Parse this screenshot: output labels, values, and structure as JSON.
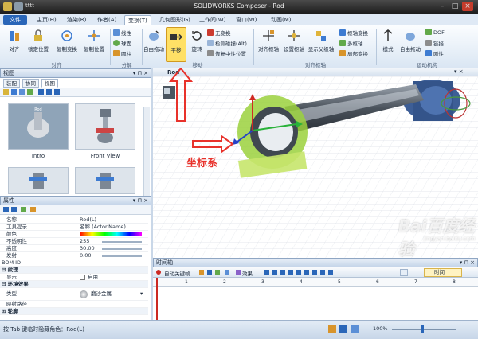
{
  "app": {
    "title": "SOLIDWORKS Composer - Rod",
    "file_tab": "文件",
    "quick_access_doc": "tttt"
  },
  "tabs": [
    {
      "label": "主页(H)"
    },
    {
      "label": "渲染(R)"
    },
    {
      "label": "作者(A)"
    },
    {
      "label": "变换(T)",
      "active": true
    },
    {
      "label": "几何图形(G)"
    },
    {
      "label": "工作间(W)"
    },
    {
      "label": "窗口(W)"
    },
    {
      "label": "动画(M)"
    }
  ],
  "ribbon": {
    "align_group": {
      "label": "对齐",
      "align_button": "对齐",
      "lock_position": "锁定位置",
      "copy_transform": "复制变换",
      "copy_position": "复制位置"
    },
    "explode_group": {
      "label": "分解",
      "linear": "线性",
      "spherical": "球面",
      "cylindrical": "圆柱"
    },
    "move_group": {
      "label": "移动",
      "free_drag": "自由拖动",
      "translate": "平移",
      "rotate": "旋转",
      "no_transform": "无变换",
      "check_collision": "检测碰撞(Alt)",
      "restore_neutral": "恢复中性位置"
    },
    "pivot_group": {
      "label": "对齐枢轴",
      "align_pivot": "对齐枢轴",
      "set_pivot": "设置枢轴",
      "show_parent_pivot": "显示父级轴",
      "pivot_transform": "枢轴变换",
      "multi_pivot": "多枢轴",
      "local_transform": "局部变换"
    },
    "kinematics_group": {
      "label": "运动机构",
      "mode": "模式",
      "free_drag": "自由拖动",
      "dof": "DOF",
      "link": "链接",
      "rigid": "刚性"
    }
  },
  "views_panel": {
    "title": "视图",
    "subtabs": [
      "装配",
      "协同",
      "视图"
    ],
    "thumbnails": [
      {
        "label": "Intro"
      },
      {
        "label": "Front View"
      }
    ]
  },
  "properties_panel": {
    "title": "属性",
    "rows": [
      {
        "key": "名称",
        "value": "Rod(L)"
      },
      {
        "key": "工具提示",
        "value": "名称 (Actor.Name)"
      },
      {
        "key": "颜色",
        "value": ""
      },
      {
        "key": "不透明性",
        "value": "255"
      },
      {
        "key": "高度",
        "value": "30.00"
      },
      {
        "key": "发射",
        "value": "0.00"
      },
      {
        "key": "BOM ID",
        "value": ""
      },
      {
        "key": "纹理",
        "value": "",
        "section": true
      },
      {
        "key": "显示",
        "value": "启用"
      },
      {
        "key": "环境效果",
        "value": "",
        "section": true
      },
      {
        "key": "类型",
        "value": "磨沙金属"
      },
      {
        "key": "映射路径",
        "value": ""
      },
      {
        "key": "轮廓",
        "value": "",
        "section": true
      }
    ]
  },
  "viewport": {
    "tab_label": "Rod",
    "annotation": "坐标系"
  },
  "timeline": {
    "title": "时间轴",
    "auto_keyframe": "自动关键帧",
    "effects": "效果",
    "time_label": "时间",
    "ticks": [
      "1",
      "2",
      "3",
      "4",
      "5",
      "6",
      "7",
      "8"
    ]
  },
  "statusbar": {
    "text": "按 Tab 键临时隐藏角色：Rod(L)",
    "zoom": "100%"
  },
  "watermark": {
    "text": "Bai百度经验",
    "url": "jingyan.baidu.com"
  },
  "colors": {
    "accent": "#2a66b8",
    "highlight": "#ffe066",
    "annotation": "#e8322b"
  }
}
